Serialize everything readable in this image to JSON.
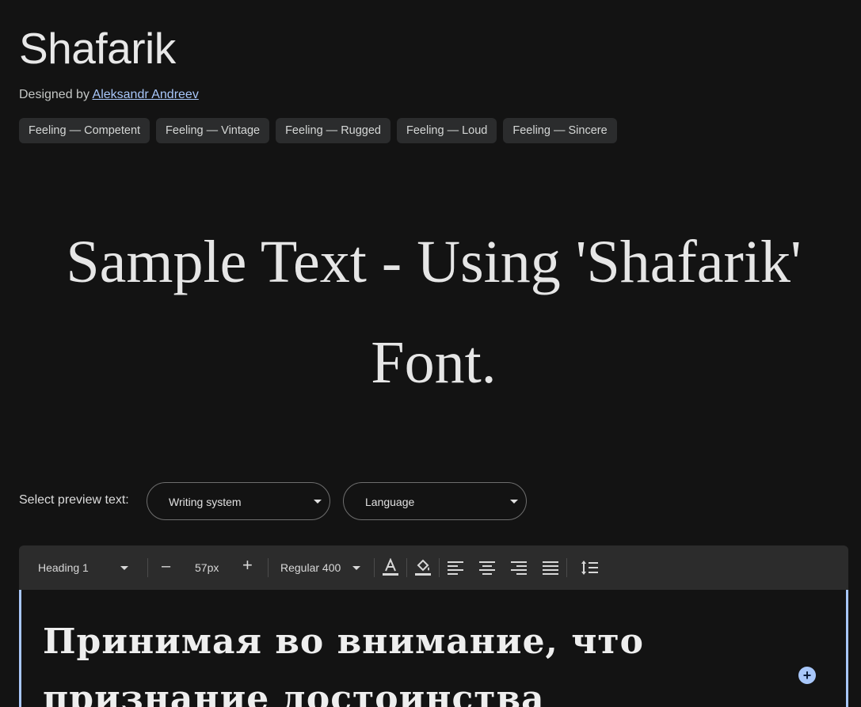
{
  "font": {
    "name": "Shafarik",
    "designed_by_label": "Designed by",
    "designer": "Aleksandr Andreev"
  },
  "tags": [
    "Feeling — Competent",
    "Feeling — Vintage",
    "Feeling — Rugged",
    "Feeling — Loud",
    "Feeling — Sincere"
  ],
  "sample_text": "Sample Text - Using 'Shafarik' Font.",
  "preview": {
    "label": "Select preview text:",
    "writing_system": "Writing system",
    "language": "Language"
  },
  "toolbar": {
    "style": "Heading 1",
    "size": "57px",
    "weight": "Regular 400",
    "decrease": "–",
    "increase": "+"
  },
  "editor": {
    "text": "Принимая во внимание, что признание достоинства"
  },
  "colors": {
    "background": "#131313",
    "accent": "#a8c7fa",
    "chip": "#2b2c2d",
    "toolbar": "#2c2c2c"
  }
}
